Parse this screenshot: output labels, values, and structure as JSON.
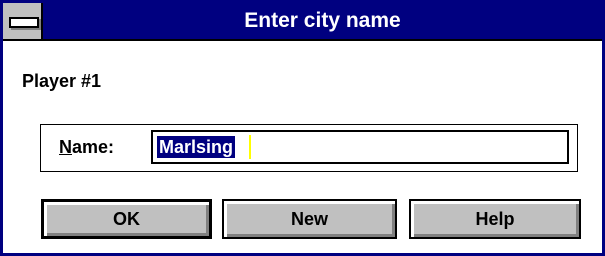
{
  "window": {
    "title": "Enter city name"
  },
  "dialog": {
    "player_label": "Player #1",
    "name_label_mnemonic": "N",
    "name_label_rest": "ame:",
    "name_value": "Marlsing"
  },
  "buttons": {
    "ok": "OK",
    "new": "New",
    "help": "Help"
  },
  "colors": {
    "titlebar": "#000080",
    "button_face": "#c0c0c0",
    "selection": "#000080"
  },
  "icons": {
    "system_menu": "system-menu-icon"
  }
}
